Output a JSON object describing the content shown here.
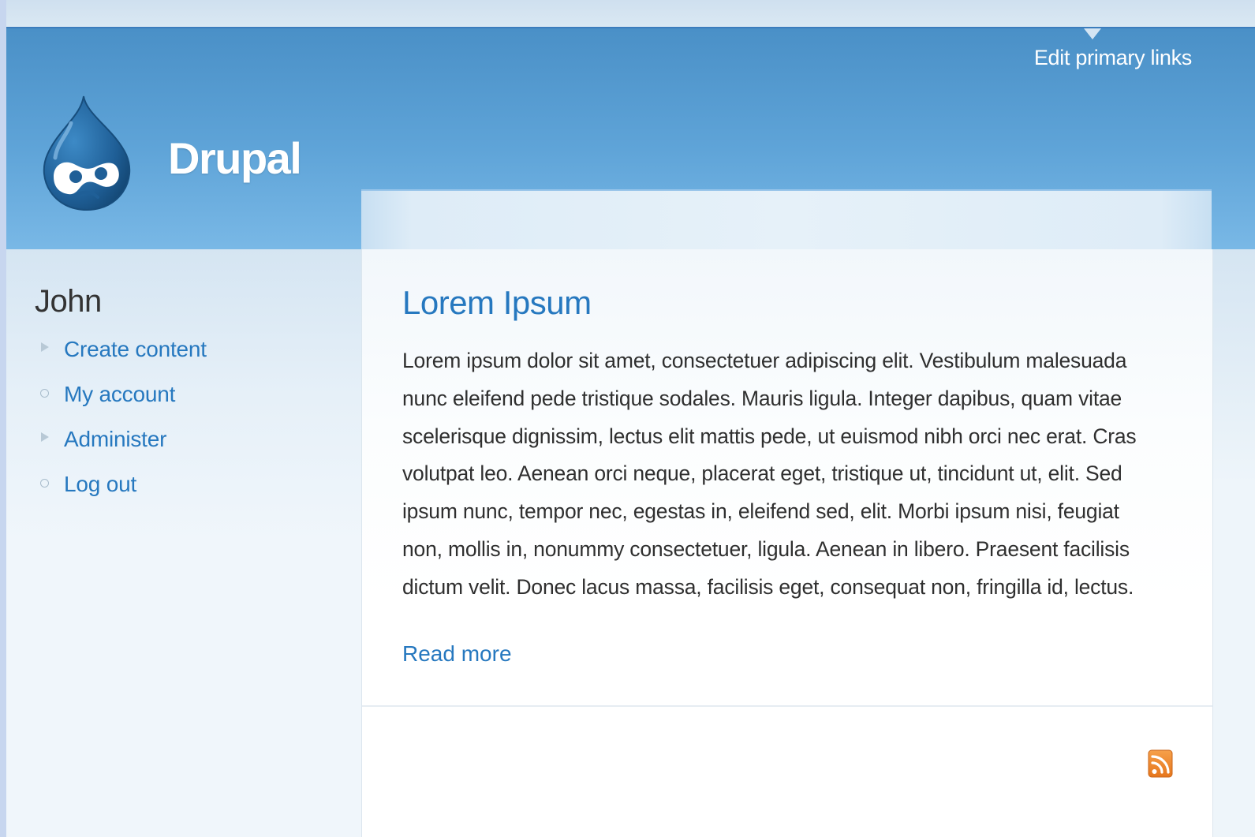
{
  "header": {
    "site_name": "Drupal",
    "primary_links_label": "Edit primary links"
  },
  "sidebar": {
    "title": "John",
    "items": [
      {
        "label": "Create content",
        "bullet": "expandable"
      },
      {
        "label": "My account",
        "bullet": "leaf"
      },
      {
        "label": "Administer",
        "bullet": "expandable"
      },
      {
        "label": "Log out",
        "bullet": "leaf"
      }
    ]
  },
  "node": {
    "title": "Lorem Ipsum",
    "body": "Lorem ipsum dolor sit amet, consectetuer adipiscing elit. Vestibulum malesuada nunc eleifend pede tristique sodales. Mauris ligula. Integer dapibus, quam vitae scelerisque dignissim, lectus elit mattis pede, ut euismod nibh orci nec erat. Cras volutpat leo. Aenean orci neque, placerat eget, tristique ut, tincidunt ut, elit. Sed ipsum nunc, tempor nec, egestas in, eleifend sed, elit. Morbi ipsum nisi, feugiat non, mollis in, nonummy consectetuer, ligula. Aenean in libero. Praesent facilisis dictum velit. Donec lacus massa, facilisis eget, consequat non, fringilla id, lectus.",
    "read_more": "Read more"
  },
  "icons": {
    "logo": "drupal-drop-logo-icon",
    "feed": "rss-feed-icon"
  },
  "colors": {
    "header_blue": "#4a90c7",
    "link_blue": "#2678bf",
    "feed_orange": "#f08a24"
  }
}
